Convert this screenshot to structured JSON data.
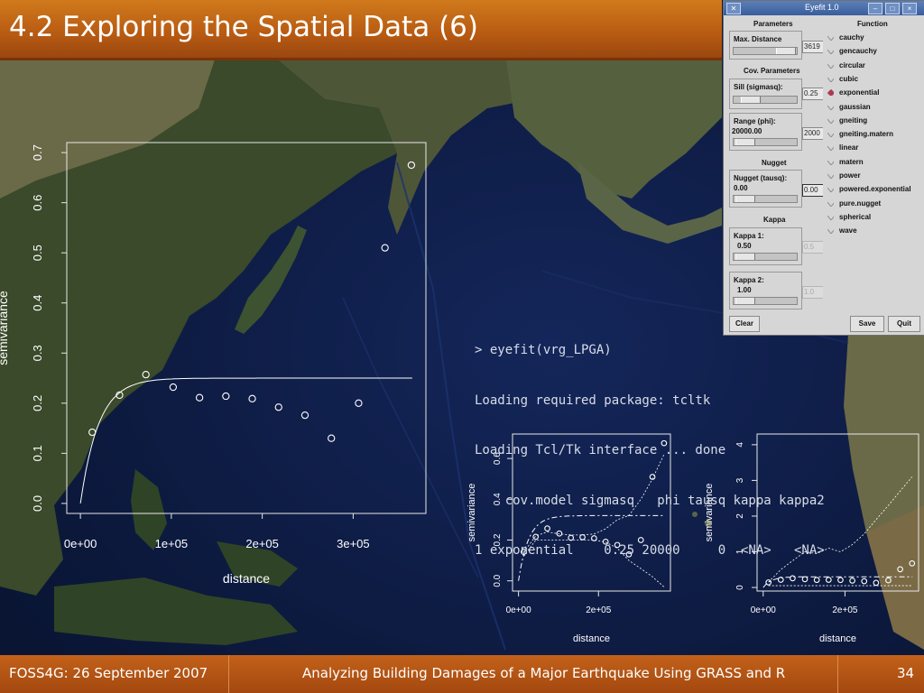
{
  "slide": {
    "title": "4.2 Exploring the Spatial Data (6)",
    "footer_left": "FOSS4G: 26 September 2007",
    "footer_center": "Analyzing Building Damages of a Major Earthquake Using GRASS and R",
    "page_number": "34",
    "colors": {
      "bar": "#b75a12",
      "text": "#ffffff"
    }
  },
  "console": {
    "lines": [
      "> eyefit(vrg_LPGA)",
      "Loading required package: tcltk",
      "Loading Tcl/Tk interface ... done",
      "    cov.model sigmasq   phi tausq kappa kappa2",
      "1 exponential    0.25 20000     0  <NA>   <NA>"
    ]
  },
  "chart_data": [
    {
      "type": "scatter",
      "xlabel": "distance",
      "ylabel": "semivariance",
      "xlim": [
        -15000,
        380000
      ],
      "ylim": [
        -0.02,
        0.72
      ],
      "xticks": [
        "0e+00",
        "1e+05",
        "2e+05",
        "3e+05"
      ],
      "xtick_values": [
        0,
        100000,
        200000,
        300000
      ],
      "yticks": [
        "0.0",
        "0.1",
        "0.2",
        "0.3",
        "0.4",
        "0.5",
        "0.6",
        "0.7"
      ],
      "ytick_values": [
        0,
        0.1,
        0.2,
        0.3,
        0.4,
        0.5,
        0.6,
        0.7
      ],
      "points": {
        "x": [
          13000,
          43000,
          72000,
          102000,
          131000,
          160000,
          189000,
          218000,
          247000,
          276000,
          306000,
          335000,
          364000
        ],
        "y": [
          0.142,
          0.216,
          0.257,
          0.232,
          0.211,
          0.214,
          0.209,
          0.192,
          0.176,
          0.13,
          0.2,
          0.51,
          0.675
        ]
      },
      "fitted_model": {
        "cov_model": "exponential",
        "sigmasq": 0.25,
        "phi": 20000,
        "tausq": 0
      }
    },
    {
      "type": "line",
      "xlabel": "distance",
      "ylabel": "semivariance",
      "xlim": [
        -15000,
        380000
      ],
      "ylim": [
        -0.05,
        0.72
      ],
      "xticks": [
        "0e+00",
        "2e+05"
      ],
      "xtick_values": [
        0,
        200000
      ],
      "yticks": [
        "0.0",
        "0.2",
        "0.4",
        "0.6"
      ],
      "ytick_values": [
        0,
        0.2,
        0.4,
        0.6
      ],
      "points": {
        "x": [
          13000,
          43000,
          72000,
          102000,
          131000,
          160000,
          189000,
          218000,
          247000,
          276000,
          306000,
          335000,
          364000
        ],
        "y": [
          0.142,
          0.216,
          0.257,
          0.232,
          0.211,
          0.214,
          0.209,
          0.192,
          0.176,
          0.13,
          0.2,
          0.51,
          0.675
        ]
      }
    },
    {
      "type": "line",
      "xlabel": "distance",
      "ylabel": "semivariance",
      "xlim": [
        -15000,
        380000
      ],
      "ylim": [
        -0.1,
        4.3
      ],
      "xticks": [
        "0e+00",
        "2e+05"
      ],
      "xtick_values": [
        0,
        200000
      ],
      "yticks": [
        "0",
        "1",
        "2",
        "3",
        "4"
      ],
      "ytick_values": [
        0,
        1,
        2,
        3,
        4
      ],
      "points": {
        "x": [
          13000,
          43000,
          72000,
          102000,
          131000,
          160000,
          189000,
          218000,
          247000,
          276000,
          306000,
          335000,
          364000
        ],
        "y": [
          0.142,
          0.216,
          0.257,
          0.232,
          0.211,
          0.214,
          0.209,
          0.192,
          0.176,
          0.13,
          0.2,
          0.51,
          0.675
        ]
      }
    }
  ],
  "eyefit": {
    "window_title": "Eyefit 1.0",
    "parameters_title": "Parameters",
    "max_distance_label": "Max. Distance",
    "max_distance_value": "3619",
    "cov_title": "Cov. Parameters",
    "sill_label": "Sill (sigmasq):",
    "sill_value": "0.25",
    "range_label": "Range (phi):",
    "range_current": "20000.00",
    "range_value": "2000",
    "nugget_title": "Nugget",
    "nugget_label": "Nugget (tausq):",
    "nugget_current": "0.00",
    "nugget_value": "0.00",
    "kappa_title": "Kappa",
    "kappa1_label": "Kappa 1:",
    "kappa1_current": "0.50",
    "kappa1_value": "0.5",
    "kappa2_label": "Kappa 2:",
    "kappa2_current": "1.00",
    "kappa2_value": "1.0",
    "function_title": "Function",
    "functions": [
      "cauchy",
      "gencauchy",
      "circular",
      "cubic",
      "exponential",
      "gaussian",
      "gneiting",
      "gneiting.matern",
      "linear",
      "matern",
      "power",
      "powered.exponential",
      "pure.nugget",
      "spherical",
      "wave"
    ],
    "selected_function": "exponential",
    "clear_label": "Clear",
    "save_label": "Save",
    "quit_label": "Quit"
  }
}
